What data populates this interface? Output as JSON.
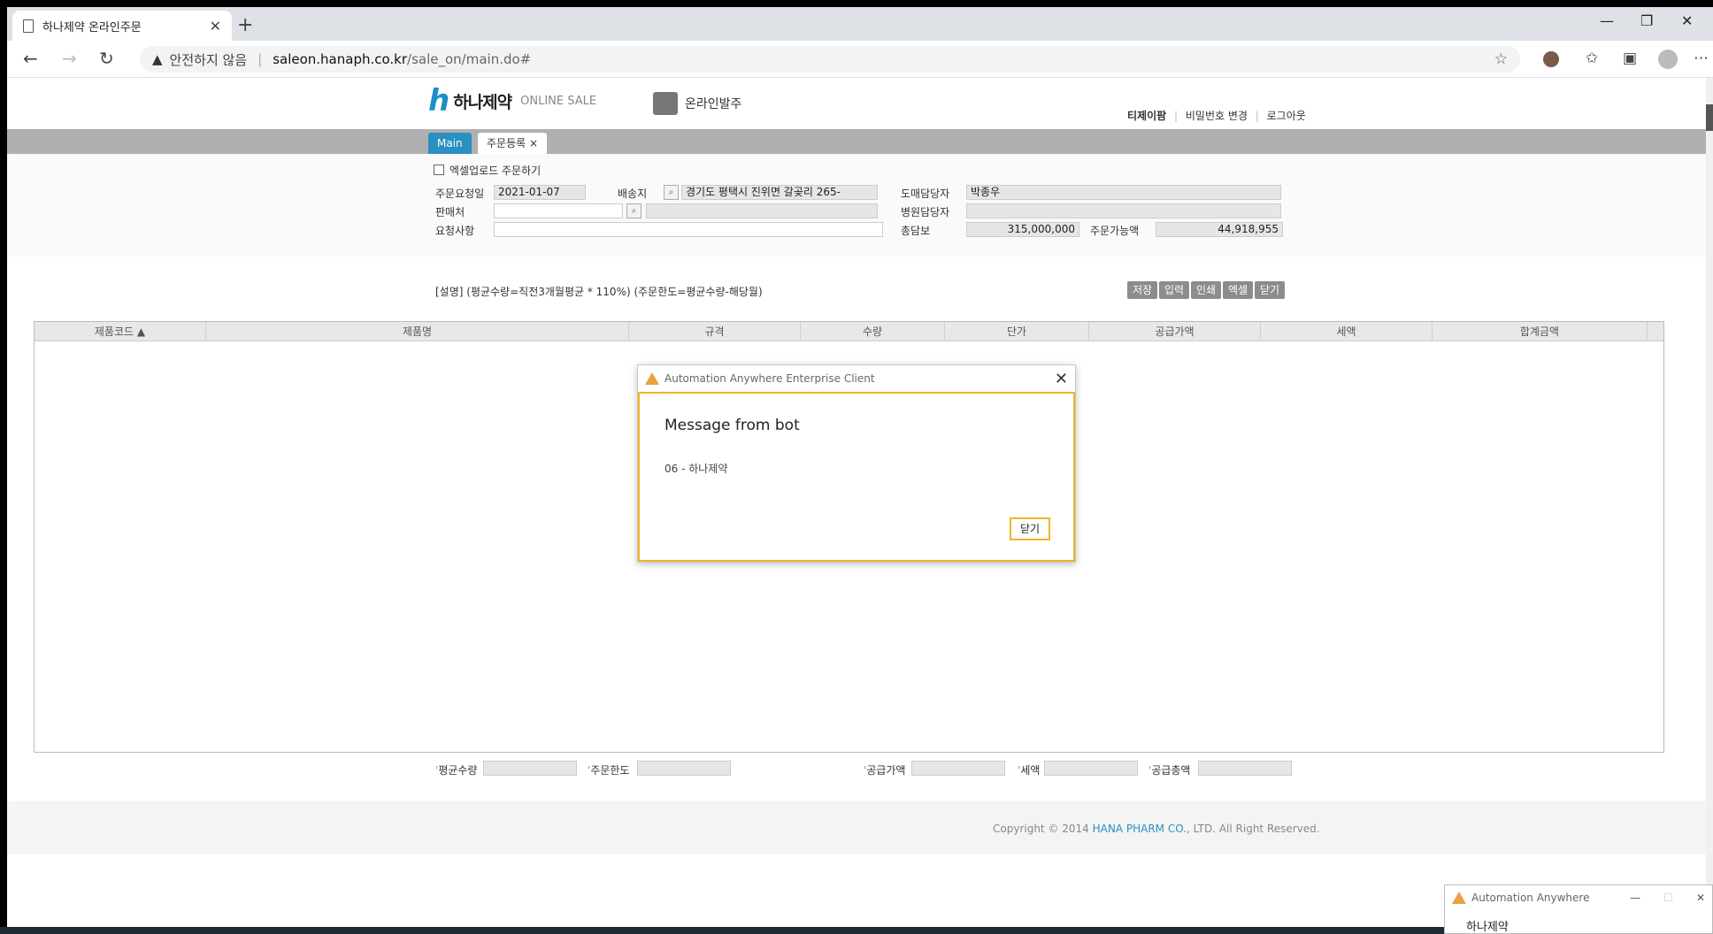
{
  "browser": {
    "tab_title": "하나제약 온라인주문",
    "url_warning": "안전하지 않음",
    "url_host": "saleon.hanaph.co.kr",
    "url_path": "/sale_on/main.do#"
  },
  "header": {
    "brand": "하나제약",
    "brand_sub": "ONLINE SALE",
    "section_title": "온라인발주",
    "user": "티제이팜",
    "change_password": "비밀번호 변경",
    "logout": "로그아웃"
  },
  "tabs": {
    "main": "Main",
    "order_reg": "주문등록"
  },
  "form": {
    "excel_upload_label": "엑셀업로드 주문하기",
    "order_date_label": "주문요청일",
    "order_date": "2021-01-07",
    "delivery_label": "배송지",
    "delivery_address": "경기도 평택시 진위면 갈곶리 265-",
    "wholesale_manager_label": "도매담당자",
    "wholesale_manager": "박종우",
    "seller_label": "판매처",
    "hospital_manager_label": "병원담당자",
    "request_label": "요청사항",
    "total_label": "총담보",
    "total_value": "315,000,000",
    "orderable_label": "주문가능액",
    "orderable_value": "44,918,955"
  },
  "description": "[설명] (평균수량=직전3개월평균 * 110%) (주문한도=평균수량-해당월)",
  "actions": {
    "save": "저장",
    "input": "입력",
    "print": "인쇄",
    "excel": "엑셀",
    "close": "닫기"
  },
  "grid": {
    "columns": [
      "제품코드 ▲",
      "제품명",
      "규격",
      "수량",
      "단가",
      "공급가액",
      "세액",
      "합계금액"
    ]
  },
  "summary": {
    "avg_qty": "평균수량",
    "order_limit": "주문한도",
    "supply_amount": "공급가액",
    "tax": "세액",
    "supply_total": "공급총액"
  },
  "footer": {
    "copyright_prefix": "Copyright © 2014 ",
    "company": "HANA PHARM CO.",
    "copyright_suffix": ", LTD. All Right Reserved."
  },
  "modal": {
    "window_title": "Automation Anywhere Enterprise Client",
    "heading": "Message from bot",
    "message": "06 - 하나제약",
    "button": "닫기"
  },
  "mini_window": {
    "title": "Automation Anywhere",
    "text": "하나제약"
  }
}
